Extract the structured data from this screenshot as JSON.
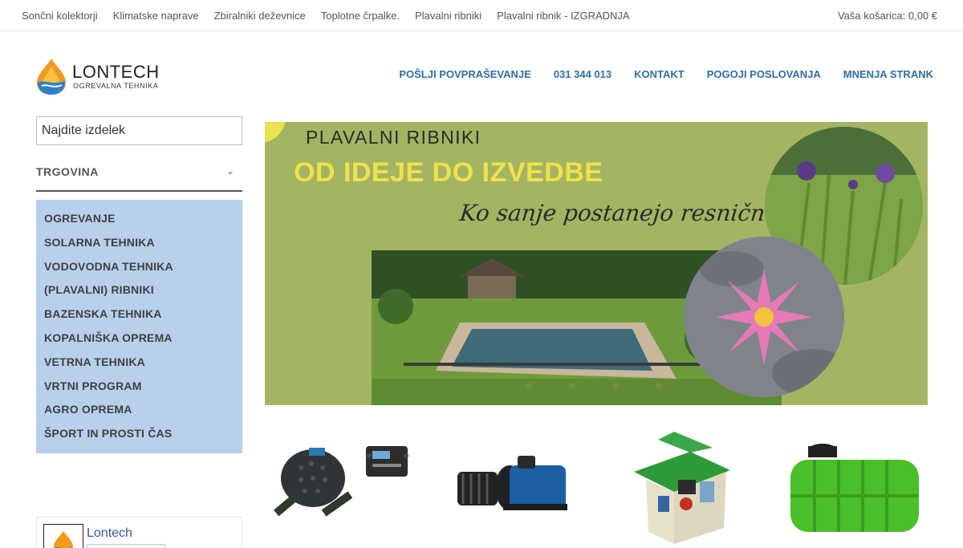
{
  "topnav": {
    "items": [
      "Sončni kolektorji",
      "Klimatske naprave",
      "Zbiralniki deževnice",
      "Toplotne črpalke.",
      "Plavalni ribniki",
      "Plavalni ribnik - IZGRADNJA"
    ],
    "cart": "Vaša košarica: 0,00 €"
  },
  "logo": {
    "title": "LONTECH",
    "subtitle": "OGREVALNA TEHNIKA"
  },
  "mainnav": {
    "items": [
      "POŠLJI POVPRAŠEVANJE",
      "031 344 013",
      "KONTAKT",
      "POGOJI POSLOVANJA",
      "MNENJA STRANK"
    ]
  },
  "search": {
    "placeholder": "Najdite izdelek"
  },
  "shop": {
    "title": "TRGOVINA",
    "categories": [
      "OGREVANJE",
      "SOLARNA TEHNIKA",
      "VODOVODNA TEHNIKA",
      "(PLAVALNI) RIBNIKI",
      "BAZENSKA TEHNIKA",
      "KOPALNIŠKA OPREMA",
      "VETRNA TEHNIKA",
      "VRTNI PROGRAM",
      "AGRO OPREMA",
      "ŠPORT IN PROSTI ČAS"
    ]
  },
  "facebook": {
    "name": "Lontech"
  },
  "banner": {
    "line1": "PLAVALNI RIBNIKI",
    "line2": "OD IDEJE DO IZVEDBE",
    "line3": "Ko sanje postanejo resničnost......",
    "slides": 4
  },
  "colors": {
    "nav": "#2f6ea8",
    "category_bg": "#b8d0ec",
    "banner_bg": "#a3b563",
    "banner_headline": "#f0e24a"
  }
}
